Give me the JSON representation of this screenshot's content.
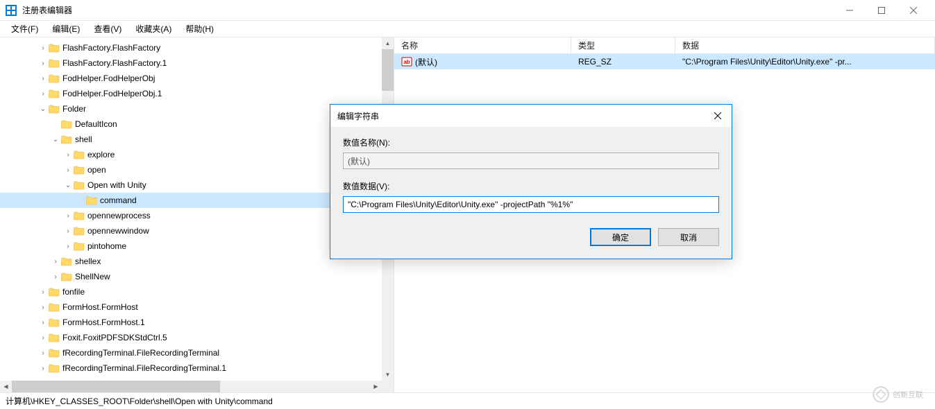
{
  "window": {
    "title": "注册表编辑器"
  },
  "menu": {
    "file": "文件(F)",
    "edit": "编辑(E)",
    "view": "查看(V)",
    "favorites": "收藏夹(A)",
    "help": "帮助(H)"
  },
  "tree": {
    "items": [
      {
        "depth": 3,
        "exp": ">",
        "label": "FlashFactory.FlashFactory"
      },
      {
        "depth": 3,
        "exp": ">",
        "label": "FlashFactory.FlashFactory.1"
      },
      {
        "depth": 3,
        "exp": ">",
        "label": "FodHelper.FodHelperObj"
      },
      {
        "depth": 3,
        "exp": ">",
        "label": "FodHelper.FodHelperObj.1"
      },
      {
        "depth": 3,
        "exp": "v",
        "label": "Folder"
      },
      {
        "depth": 4,
        "exp": "",
        "label": "DefaultIcon"
      },
      {
        "depth": 4,
        "exp": "v",
        "label": "shell"
      },
      {
        "depth": 5,
        "exp": ">",
        "label": "explore"
      },
      {
        "depth": 5,
        "exp": ">",
        "label": "open"
      },
      {
        "depth": 5,
        "exp": "v",
        "label": "Open with Unity"
      },
      {
        "depth": 6,
        "exp": "",
        "label": "command",
        "selected": true
      },
      {
        "depth": 5,
        "exp": ">",
        "label": "opennewprocess"
      },
      {
        "depth": 5,
        "exp": ">",
        "label": "opennewwindow"
      },
      {
        "depth": 5,
        "exp": ">",
        "label": "pintohome"
      },
      {
        "depth": 4,
        "exp": ">",
        "label": "shellex"
      },
      {
        "depth": 4,
        "exp": ">",
        "label": "ShellNew"
      },
      {
        "depth": 3,
        "exp": ">",
        "label": "fonfile"
      },
      {
        "depth": 3,
        "exp": ">",
        "label": "FormHost.FormHost"
      },
      {
        "depth": 3,
        "exp": ">",
        "label": "FormHost.FormHost.1"
      },
      {
        "depth": 3,
        "exp": ">",
        "label": "Foxit.FoxitPDFSDKStdCtrl.5"
      },
      {
        "depth": 3,
        "exp": ">",
        "label": "fRecordingTerminal.FileRecordingTerminal"
      },
      {
        "depth": 3,
        "exp": ">",
        "label": "fRecordingTerminal.FileRecordingTerminal.1"
      }
    ]
  },
  "values": {
    "header": {
      "name": "名称",
      "type": "类型",
      "data": "数据"
    },
    "rows": [
      {
        "name": "(默认)",
        "type": "REG_SZ",
        "data": "\"C:\\Program Files\\Unity\\Editor\\Unity.exe\" -pr...",
        "selected": true
      }
    ]
  },
  "status": {
    "path": "计算机\\HKEY_CLASSES_ROOT\\Folder\\shell\\Open with Unity\\command"
  },
  "dialog": {
    "title": "编辑字符串",
    "name_label": "数值名称(N):",
    "name_value": "(默认)",
    "data_label": "数值数据(V):",
    "data_value": "\"C:\\Program Files\\Unity\\Editor\\Unity.exe\" -projectPath \"%1%\"",
    "ok": "确定",
    "cancel": "取消"
  },
  "watermark": {
    "text": "创新互联"
  }
}
